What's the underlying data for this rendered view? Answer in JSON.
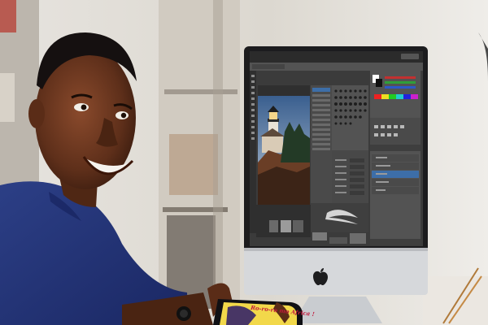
{
  "scene": {
    "subject": "person",
    "screen_app": "photo-editor",
    "monitor_brand_icon": "apple-logo-icon"
  },
  "editor": {
    "window_title": "",
    "top_right_label": "",
    "colors": {
      "canvas": "#3b3b3b",
      "panel": "#4a4a4a",
      "highlight": "#3d6ea8"
    }
  },
  "tablet": {
    "text": "Ro-ro-ro mo Africa !"
  }
}
